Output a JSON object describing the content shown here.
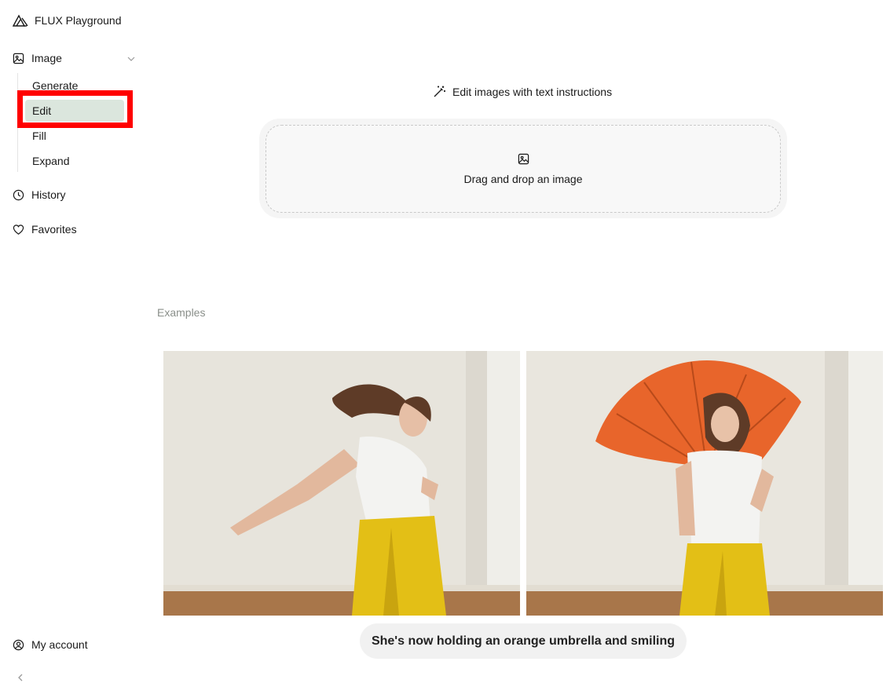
{
  "app": {
    "title": "FLUX Playground"
  },
  "sidebar": {
    "section": {
      "label": "Image"
    },
    "sub_items": [
      {
        "label": "Generate",
        "active": false
      },
      {
        "label": "Edit",
        "active": true
      },
      {
        "label": "Fill",
        "active": false
      },
      {
        "label": "Expand",
        "active": false
      }
    ],
    "history": {
      "label": "History"
    },
    "favorites": {
      "label": "Favorites"
    },
    "account": {
      "label": "My account"
    }
  },
  "main": {
    "headline": "Edit images with text instructions",
    "dropzone": {
      "text": "Drag and drop an image"
    },
    "examples_label": "Examples",
    "example": {
      "caption": "She's now holding an orange umbrella and smiling"
    }
  },
  "colors": {
    "active_bg": "#dbe6dd",
    "highlight": "#ff0000",
    "umbrella": "#e8652b",
    "pants": "#e6c21a"
  }
}
